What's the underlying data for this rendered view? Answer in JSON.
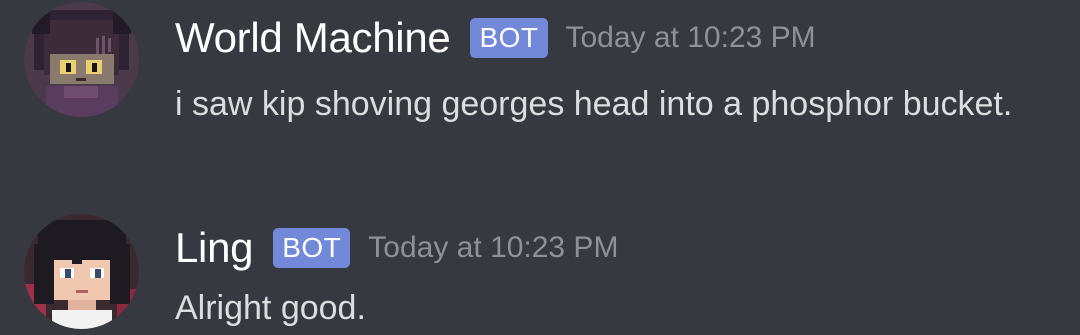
{
  "messages": [
    {
      "author": "World Machine",
      "tag": "BOT",
      "timestamp": "Today at 10:23 PM",
      "text": "i saw kip shoving georges head into a phosphor bucket.",
      "avatar_icon": "pixel-art-cat-avatar-icon"
    },
    {
      "author": "Ling",
      "tag": "BOT",
      "timestamp": "Today at 10:23 PM",
      "text": "Alright good.",
      "avatar_icon": "pixel-art-girl-avatar-icon"
    }
  ],
  "colors": {
    "background": "#36393f",
    "username": "#ffffff",
    "bot_tag": "#7289da",
    "timestamp": "#8e9297",
    "message_text": "#dcddde"
  }
}
